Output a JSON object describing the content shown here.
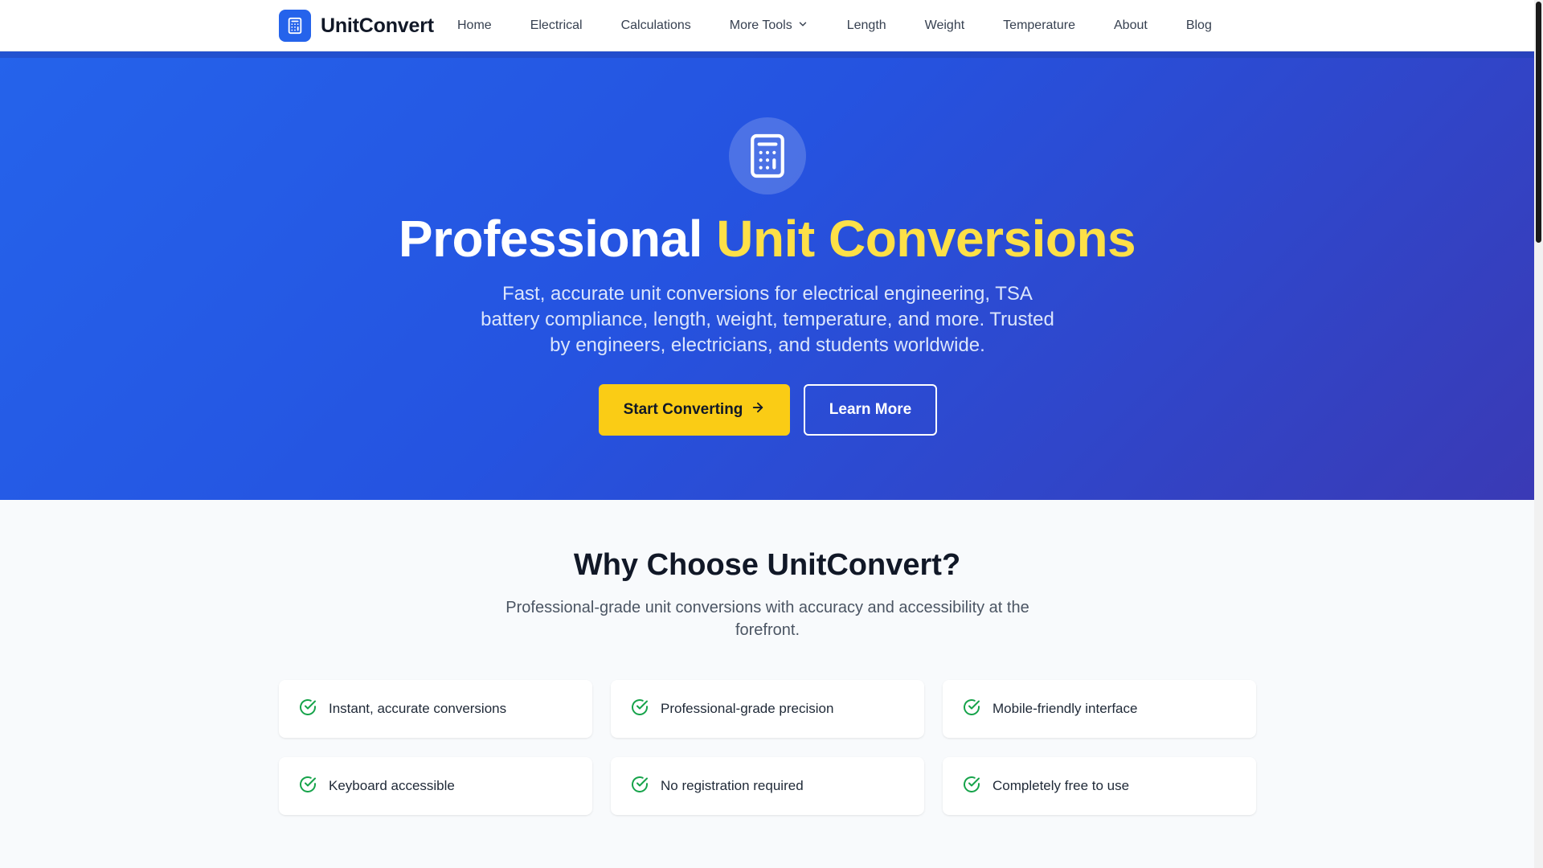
{
  "header": {
    "brand": "UnitConvert",
    "nav": [
      {
        "label": "Home"
      },
      {
        "label": "Electrical"
      },
      {
        "label": "Calculations"
      },
      {
        "label": "More Tools",
        "icon": "chevron-down-icon"
      },
      {
        "label": "Length"
      },
      {
        "label": "Weight"
      },
      {
        "label": "Temperature"
      },
      {
        "label": "About"
      },
      {
        "label": "Blog"
      }
    ]
  },
  "hero": {
    "title_main": "Professional ",
    "title_accent": "Unit Conversions",
    "subtitle": "Fast, accurate unit conversions for electrical engineering, TSA battery compliance, length, weight, temperature, and more. Trusted by engineers, electricians, and students worldwide.",
    "primary_button": "Start Converting",
    "secondary_button": "Learn More"
  },
  "why": {
    "title": "Why Choose UnitConvert?",
    "subtitle": "Professional-grade unit conversions with accuracy and accessibility at the forefront.",
    "features": [
      {
        "label": "Instant, accurate conversions"
      },
      {
        "label": "Professional-grade precision"
      },
      {
        "label": "Mobile-friendly interface"
      },
      {
        "label": "Keyboard accessible"
      },
      {
        "label": "No registration required"
      },
      {
        "label": "Completely free to use"
      }
    ]
  },
  "colors": {
    "brand": "#2563eb",
    "accent": "#fde047",
    "button": "#facc15",
    "check": "#16a34a"
  }
}
